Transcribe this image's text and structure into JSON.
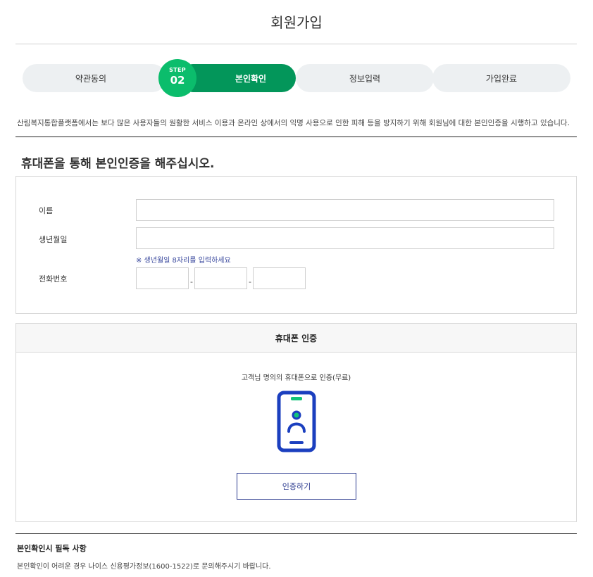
{
  "page_title": "회원가입",
  "steps": [
    {
      "label": "약관동의"
    },
    {
      "label": "본인확인",
      "active": true
    },
    {
      "label": "정보입력"
    },
    {
      "label": "가입완료"
    }
  ],
  "active_step": {
    "badge_label": "STEP",
    "number": "02"
  },
  "intro_text": "산림복지통합플랫폼에서는 보다 많은 사용자들의 원활한 서비스 이용과 온라인 상에서의 익명 사용으로 인한 피해 등을 방지하기 위해 회원님에 대한 본인인증을 시행하고 있습니다.",
  "section_heading": "휴대폰을 통해 본인인증을 해주십시오.",
  "form": {
    "name_label": "이름",
    "name_value": "",
    "birth_label": "생년월일",
    "birth_value": "",
    "birth_hint": "※ 생년월일 8자리를 입력하세요",
    "phone_label": "전화번호",
    "phone_parts": [
      "",
      "",
      ""
    ],
    "phone_separator": "-"
  },
  "auth": {
    "title": "휴대폰 인증",
    "description": "고객님 명의의 휴대폰으로 인증(무료)",
    "icon": "mobile-phone-person-icon",
    "button_label": "인증하기"
  },
  "notice": {
    "title": "본인확인시 필독 사항",
    "text": "본인확인이 어려운 경우 나이스 신용평가정보(1600-1522)로 문의해주시기 바랍니다."
  },
  "colors": {
    "active_step": "#03965a",
    "step_badge": "#0bbd6c",
    "inactive_step": "#edf0f2",
    "icon_blue": "#1b3fbf",
    "icon_green": "#12c47a",
    "button_border": "#2b3a8f"
  }
}
